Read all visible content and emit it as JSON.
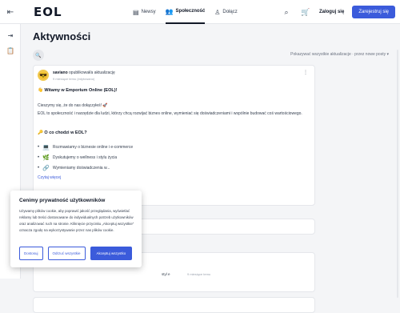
{
  "header": {
    "logo": "EOL",
    "nav": [
      {
        "label": "Newsy",
        "icon": "newspaper-icon"
      },
      {
        "label": "Społeczność",
        "icon": "users-icon"
      },
      {
        "label": "Dołącz",
        "icon": "user-plus-icon"
      }
    ],
    "login_label": "Zaloguj się",
    "register_label": "Zarejestruj się"
  },
  "main": {
    "title": "Aktywności",
    "filter": "Pokazywać wszystkie aktualizacje · przez nowe posty ▾"
  },
  "post": {
    "author": "saviano",
    "action": " opublikował/a aktualizację",
    "time": "9 miesiące temu (edytowano)",
    "title": "Witamy w Emporium Online (EOL)!",
    "intro": "Cieszymy się, że do nas dołączyłeś!",
    "desc": "EOL to społeczność i narzędzie dla ludzi, którzy chcą rozwijać biznes online, wymieniać się doświadczeniami i wspólnie budować coś wartościowego.",
    "section_title": "O co chodzi w EOL?",
    "bullets": [
      "Rozmawiamy o biznesie online i e-commerce",
      "Dyskutujemy o wellness i stylu życia",
      "Wymieniamy doświadczenia w..."
    ],
    "read_more": "Czytaj więcej"
  },
  "card3": {
    "text": "styl e",
    "time": "9 miesiące temu"
  },
  "cookie": {
    "title": "Cenimy prywatność użytkowników",
    "body": "Używamy plików cookie, aby poprawić jakość przeglądania, wyświetlać reklamy lub treści dostosowane do indywidualnych potrzeb użytkowników oraz analizować ruch na stronie. Kliknięcie przycisku „Akceptuj wszystkie” oznacza zgodę na wykorzystywanie przez nas plików cookie.",
    "btn_customize": "Dostosuj",
    "btn_reject": "Odrzuć wszystkie",
    "btn_accept": "Akceptuj wszystko"
  },
  "colors": {
    "accent": "#3b5bdb"
  }
}
